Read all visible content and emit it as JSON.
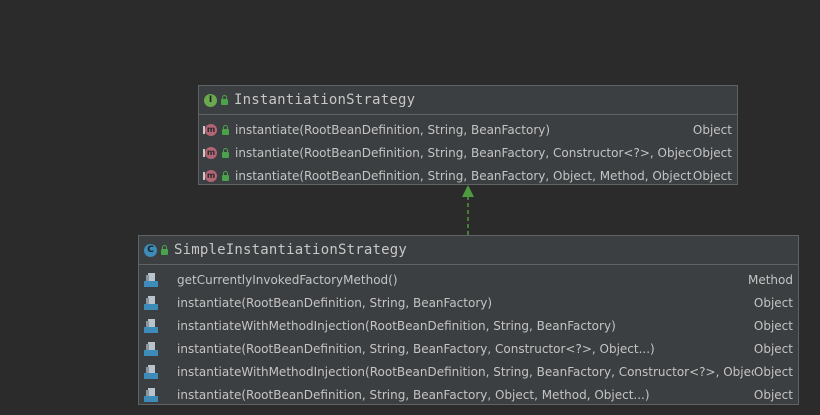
{
  "interface_box": {
    "title": "InstantiationStrategy",
    "badge": "I",
    "method_badge": "m",
    "methods": [
      {
        "signature": "instantiate(RootBeanDefinition, String, BeanFactory)",
        "returns": "Object"
      },
      {
        "signature": "instantiate(RootBeanDefinition, String, BeanFactory, Constructor<?>, Object...)",
        "returns": "Object"
      },
      {
        "signature": "instantiate(RootBeanDefinition, String, BeanFactory, Object, Method, Object...)",
        "returns": "Object"
      }
    ]
  },
  "class_box": {
    "title": "SimpleInstantiationStrategy",
    "badge": "C",
    "methods": [
      {
        "signature": "getCurrentlyInvokedFactoryMethod()",
        "returns": "Method"
      },
      {
        "signature": "instantiate(RootBeanDefinition, String, BeanFactory)",
        "returns": "Object"
      },
      {
        "signature": "instantiateWithMethodInjection(RootBeanDefinition, String, BeanFactory)",
        "returns": "Object"
      },
      {
        "signature": "instantiate(RootBeanDefinition, String, BeanFactory, Constructor<?>, Object...)",
        "returns": "Object"
      },
      {
        "signature": "instantiateWithMethodInjection(RootBeanDefinition, String, BeanFactory, Constructor<?>, Object...)",
        "returns": "Object"
      },
      {
        "signature": "instantiate(RootBeanDefinition, String, BeanFactory, Object, Method, Object...)",
        "returns": "Object"
      }
    ]
  },
  "colors": {
    "background": "#2b2b2b",
    "box": "#3c3f41",
    "border": "#5e6366",
    "interface_badge": "#6aa84f",
    "class_badge": "#3d8bb8",
    "method_badge": "#b36575",
    "edge": "#4e9a3e"
  },
  "icons": {
    "interface": "interface-icon",
    "class": "class-icon",
    "method": "method-icon",
    "public": "lock-icon",
    "implemented_method": "implemented-method-icon"
  }
}
